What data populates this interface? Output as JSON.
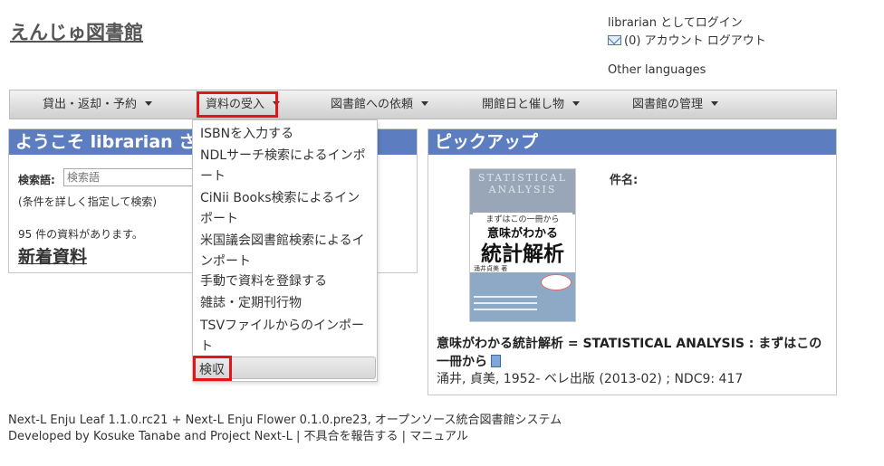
{
  "header": {
    "site_title": "えんじゅ図書館",
    "login_status": "librarian としてログイン",
    "message_count": "(0)",
    "account_link": "アカウント",
    "logout_link": "ログアウト",
    "other_languages": "Other languages"
  },
  "nav": {
    "items": [
      {
        "label": "貸出・返却・予約"
      },
      {
        "label": "資料の受入"
      },
      {
        "label": "図書館への依頼"
      },
      {
        "label": "開館日と催し物"
      },
      {
        "label": "図書館の管理"
      }
    ],
    "dropdown": [
      {
        "label": "ISBNを入力する"
      },
      {
        "label": "NDLサーチ検索によるインポート"
      },
      {
        "label": "CiNii Books検索によるインポート"
      },
      {
        "label": "米国議会図書館検索によるインポート"
      },
      {
        "label": "手動で資料を登録する"
      },
      {
        "label": "雑誌・定期刊行物"
      },
      {
        "label": "TSVファイルからのインポート"
      },
      {
        "label": "検収"
      }
    ]
  },
  "welcome": {
    "title": "ようこそ librarian さん",
    "search_label": "検索語:",
    "search_placeholder": "検索語",
    "advanced_open": "(",
    "advanced_link": "条件を詳しく指定して検索",
    "advanced_close": ")",
    "count_text": "95 件の資料があります。",
    "new_items": "新着資料"
  },
  "pickup": {
    "title": "ピックアップ",
    "subject_label": "件名:",
    "cover": {
      "en_title": "STATISTICAL ANALYSIS",
      "subtitle": "まずはこの一冊から",
      "title_line1": "意味がわかる",
      "title_line2": "統計解析",
      "author": "涌井貞美 著"
    },
    "book_title": "意味がわかる統計解析 = STATISTICAL ANALYSIS : まずはこの一冊から",
    "author": "涌井, 貞美, 1952-",
    "publisher": "ベレ出版",
    "date": "(2013-02)",
    "separator": ";",
    "ndc": "NDC9: 417"
  },
  "footer": {
    "leaf": "Next-L Enju Leaf 1.1.0.rc21",
    "plus": "+",
    "flower": "Next-L Enju Flower 0.1.0.pre23",
    "tagline": ", オープンソース統合図書館システム",
    "developed_by": "Developed by",
    "dev1": "Kosuke Tanabe",
    "and": "and",
    "dev2": "Project Next-L",
    "sep": "|",
    "report": "不具合を報告する",
    "manual": "マニュアル"
  },
  "colors": {
    "panel_header": "#5c7ec0",
    "highlight": "#e0161c"
  }
}
